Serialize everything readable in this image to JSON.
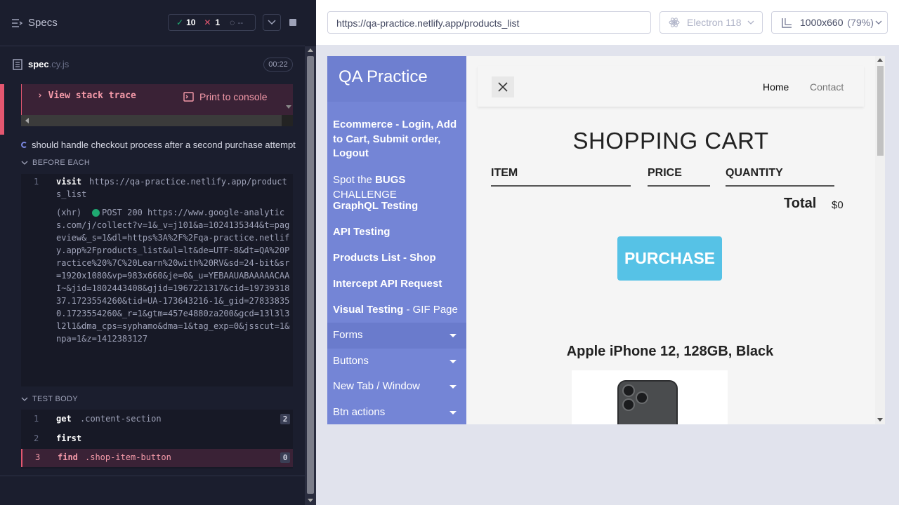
{
  "reporter": {
    "specs_label": "Specs",
    "passed": "10",
    "failed": "1",
    "pending": "--",
    "spec_file": "spec",
    "spec_ext": ".cy.js",
    "duration": "00:22",
    "view_stack_trace": "View stack trace",
    "print_to_console": "Print to console",
    "test_title": "should handle checkout process after a second purchase attempt",
    "before_each_label": "BEFORE EACH",
    "test_body_label": "TEST BODY",
    "before_each": [
      {
        "num": "1",
        "name": "visit",
        "message": "https://qa-practice.netlify.app/products_list"
      },
      {
        "num": "",
        "name": "(xhr)",
        "message": "POST 200 https://www.google-analytics.com/j/collect?v=1&_v=j101&a=1024135344&t=pageview&_s=1&dl=https%3A%2F%2Fqa-practice.netlify.app%2Fproducts_list&ul=lt&de=UTF-8&dt=QA%20Practice%20%7C%20Learn%20with%20RV&sd=24-bit&sr=1920x1080&vp=983x660&je=0&_u=YEBAAUABAAAAACAAI~&jid=1802443408&gjid=1967221317&cid=1973931837.1723554260&tid=UA-173643216-1&_gid=278338350.1723554260&_r=1&gtm=457e4880za200&gcd=13l3l3l2l1&dma_cps=syphamo&dma=1&tag_exp=0&jsscut=1&npa=1&z=1412383127"
      }
    ],
    "test_body": [
      {
        "num": "1",
        "name": "get",
        "message": ".content-section",
        "badge": "2"
      },
      {
        "num": "2",
        "name": "first",
        "message": "",
        "badge": ""
      },
      {
        "num": "3",
        "name": "find",
        "message": ".shop-item-button",
        "badge": "0"
      }
    ]
  },
  "browser": {
    "url": "https://qa-practice.netlify.app/products_list",
    "browser_name": "Electron 118",
    "viewport": "1000x660",
    "zoom": "(79%)"
  },
  "site": {
    "brand": "QA Practice",
    "nav": [
      {
        "bold": "Ecommerce - Login, Add to Cart, Submit order, Logout",
        "rest": ""
      },
      {
        "pre": "Spot the ",
        "bold": "BUGS",
        "rest": " CHALLENGE"
      },
      {
        "bold": "GraphQL Testing",
        "rest": ""
      },
      {
        "bold": "API Testing",
        "rest": ""
      },
      {
        "bold": "Products List - Shop",
        "rest": ""
      },
      {
        "bold": "Intercept API Request",
        "rest": ""
      },
      {
        "bold": "Visual Testing",
        "rest": " - GIF Page"
      }
    ],
    "dropdowns": [
      "Forms",
      "Buttons",
      "New Tab / Window",
      "Btn actions"
    ],
    "header_links": [
      "Home",
      "Contact"
    ],
    "cart_title": "SHOPPING CART",
    "columns": [
      "ITEM",
      "PRICE",
      "QUANTITY"
    ],
    "total_label": "Total",
    "total_value": "$0",
    "purchase_label": "PURCHASE",
    "product_title": "Apple iPhone 12, 128GB, Black"
  },
  "colors": {
    "reporter_bg": "#1b1e2e",
    "fail": "#e45770",
    "pass": "#1fa971",
    "nav": "#7485d6",
    "purchase": "#56c2e6"
  }
}
